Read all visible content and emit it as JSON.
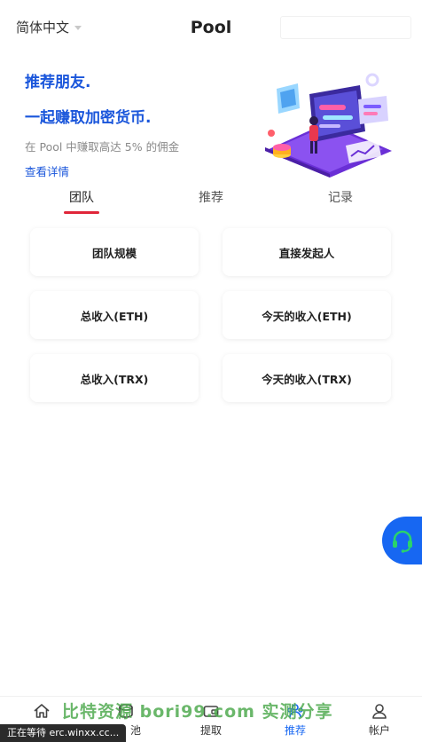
{
  "header": {
    "language": "简体中文",
    "title": "Pool"
  },
  "banner": {
    "line1": "推荐朋友.",
    "line2": "一起赚取加密货币.",
    "subtitle": "在 Pool 中赚取高达 5% 的佣金",
    "link": "查看详情"
  },
  "tabs": [
    {
      "label": "团队"
    },
    {
      "label": "推荐"
    },
    {
      "label": "记录"
    }
  ],
  "active_tab": 0,
  "cards": [
    {
      "label": "团队规模"
    },
    {
      "label": "直接发起人"
    },
    {
      "label": "总收入(ETH)"
    },
    {
      "label": "今天的收入(ETH)"
    },
    {
      "label": "总收入(TRX)"
    },
    {
      "label": "今天的收入(TRX)"
    }
  ],
  "bottom_nav": [
    {
      "label": "",
      "icon": "home-icon"
    },
    {
      "label": "池",
      "icon": "pool-icon"
    },
    {
      "label": "提取",
      "icon": "wallet-icon"
    },
    {
      "label": "推荐",
      "icon": "referral-icon"
    },
    {
      "label": "帐户",
      "icon": "user-icon"
    }
  ],
  "overlay": {
    "watermark": "比特资源 bori99.com 实测分享",
    "status": "正在等待 erc.winxx.cc..."
  },
  "colors": {
    "accent": "#1767f2",
    "banner_text": "#1a56db",
    "tab_indicator": "#e0263a"
  }
}
